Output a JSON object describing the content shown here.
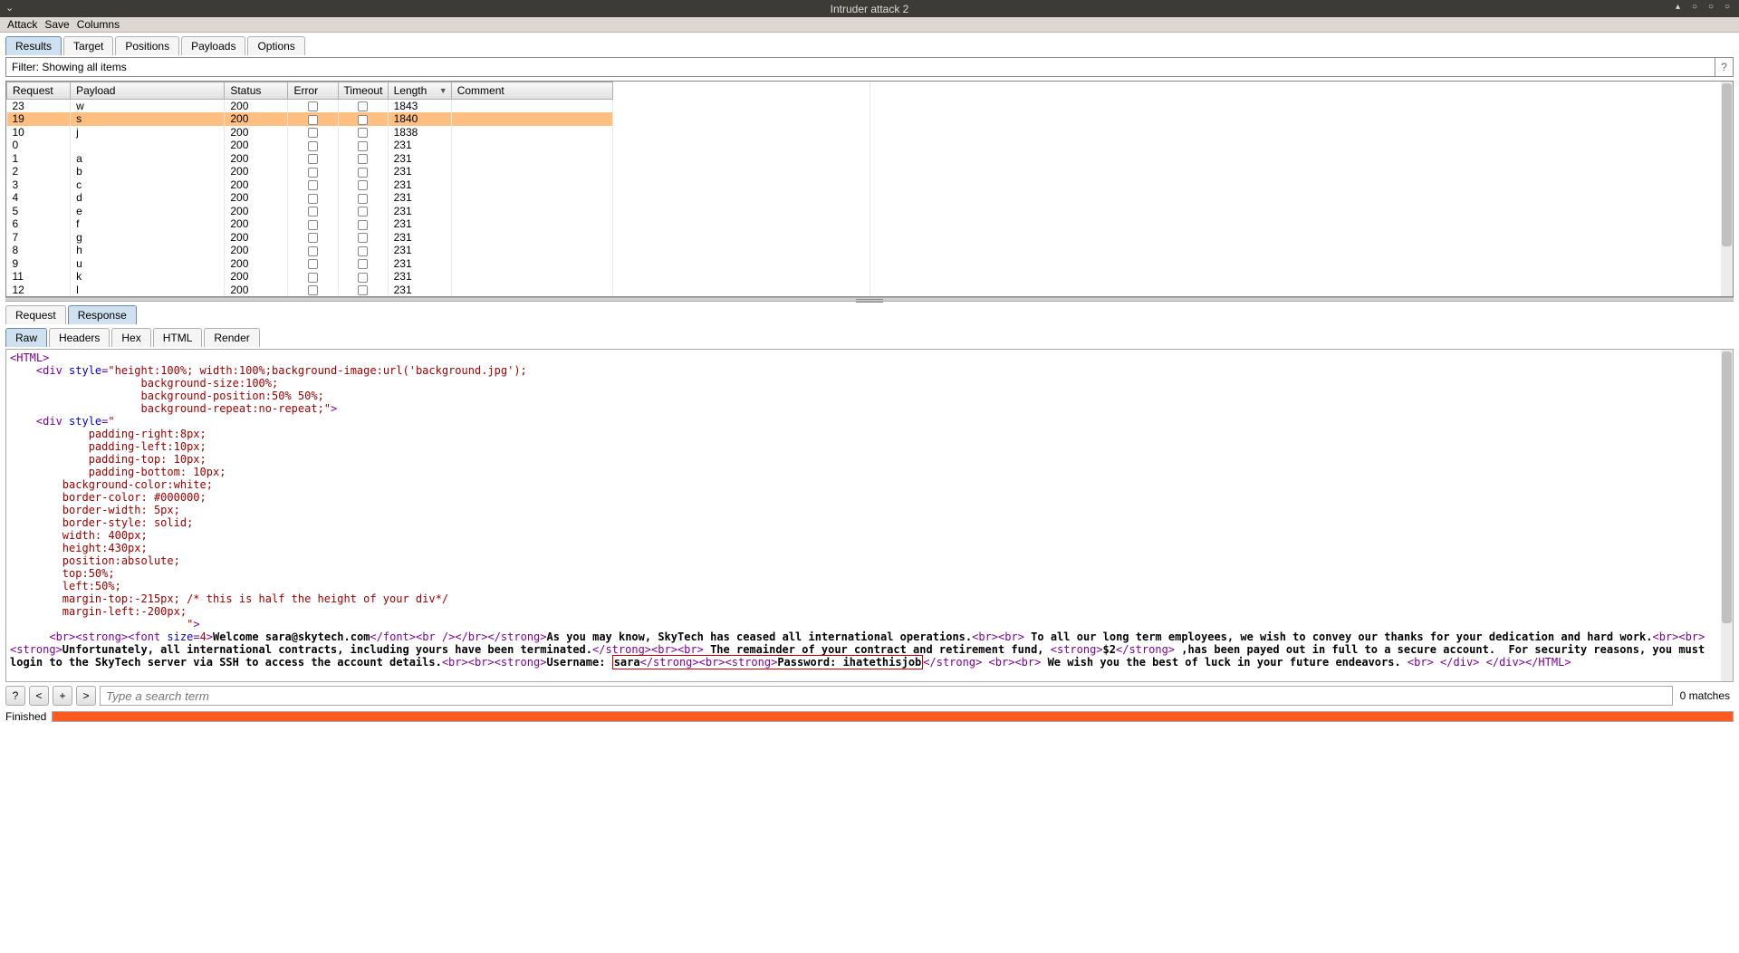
{
  "title": "Intruder attack 2",
  "menubar": {
    "items": [
      "Attack",
      "Save",
      "Columns"
    ]
  },
  "main_tabs": [
    "Results",
    "Target",
    "Positions",
    "Payloads",
    "Options"
  ],
  "main_tab_active": 0,
  "filter": {
    "text": "Filter: Showing all items"
  },
  "columns": [
    "Request",
    "Payload",
    "Status",
    "Error",
    "Timeout",
    "Length",
    "Comment"
  ],
  "sort_column": 5,
  "rows": [
    {
      "request": "23",
      "payload": "w",
      "status": "200",
      "length": "1843",
      "selected": false
    },
    {
      "request": "19",
      "payload": "s",
      "status": "200",
      "length": "1840",
      "selected": true
    },
    {
      "request": "10",
      "payload": "j",
      "status": "200",
      "length": "1838",
      "selected": false
    },
    {
      "request": "0",
      "payload": "",
      "status": "200",
      "length": "231",
      "selected": false
    },
    {
      "request": "1",
      "payload": "a",
      "status": "200",
      "length": "231",
      "selected": false
    },
    {
      "request": "2",
      "payload": "b",
      "status": "200",
      "length": "231",
      "selected": false
    },
    {
      "request": "3",
      "payload": "c",
      "status": "200",
      "length": "231",
      "selected": false
    },
    {
      "request": "4",
      "payload": "d",
      "status": "200",
      "length": "231",
      "selected": false
    },
    {
      "request": "5",
      "payload": "e",
      "status": "200",
      "length": "231",
      "selected": false
    },
    {
      "request": "6",
      "payload": "f",
      "status": "200",
      "length": "231",
      "selected": false
    },
    {
      "request": "7",
      "payload": "g",
      "status": "200",
      "length": "231",
      "selected": false
    },
    {
      "request": "8",
      "payload": "h",
      "status": "200",
      "length": "231",
      "selected": false
    },
    {
      "request": "9",
      "payload": "u",
      "status": "200",
      "length": "231",
      "selected": false
    },
    {
      "request": "11",
      "payload": "k",
      "status": "200",
      "length": "231",
      "selected": false
    },
    {
      "request": "12",
      "payload": "l",
      "status": "200",
      "length": "231",
      "selected": false
    }
  ],
  "sub_tabs": [
    "Request",
    "Response"
  ],
  "sub_tab_active": 1,
  "view_tabs": [
    "Raw",
    "Headers",
    "Hex",
    "HTML",
    "Render"
  ],
  "view_tab_active": 0,
  "search": {
    "placeholder": "Type a search term",
    "matches": "0 matches",
    "btn_help": "?",
    "btn_prev": "<",
    "btn_next": ">",
    "btn_add": "+"
  },
  "status": {
    "label": "Finished"
  },
  "response_tokens": [
    {
      "t": "tag",
      "v": "<HTML>"
    },
    {
      "t": "nl"
    },
    {
      "t": "sp",
      "v": "    "
    },
    {
      "t": "tag",
      "v": "<div "
    },
    {
      "t": "attr",
      "v": "style"
    },
    {
      "t": "tag",
      "v": "="
    },
    {
      "t": "val",
      "v": "\"height:100%; width:100%;background-image:url('background.jpg');"
    },
    {
      "t": "nl"
    },
    {
      "t": "sp",
      "v": "                    "
    },
    {
      "t": "val",
      "v": "background-size:100%;"
    },
    {
      "t": "nl"
    },
    {
      "t": "sp",
      "v": "                    "
    },
    {
      "t": "val",
      "v": "background-position:50% 50%;"
    },
    {
      "t": "nl"
    },
    {
      "t": "sp",
      "v": "                    "
    },
    {
      "t": "val",
      "v": "background-repeat:no-repeat;\""
    },
    {
      "t": "tag",
      "v": ">"
    },
    {
      "t": "nl"
    },
    {
      "t": "sp",
      "v": "    "
    },
    {
      "t": "tag",
      "v": "<div "
    },
    {
      "t": "attr",
      "v": "style"
    },
    {
      "t": "tag",
      "v": "="
    },
    {
      "t": "val",
      "v": "\""
    },
    {
      "t": "nl"
    },
    {
      "t": "sp",
      "v": "            "
    },
    {
      "t": "val",
      "v": "padding-right:8px;"
    },
    {
      "t": "nl"
    },
    {
      "t": "sp",
      "v": "            "
    },
    {
      "t": "val",
      "v": "padding-left:10px;"
    },
    {
      "t": "nl"
    },
    {
      "t": "sp",
      "v": "            "
    },
    {
      "t": "val",
      "v": "padding-top: 10px;"
    },
    {
      "t": "nl"
    },
    {
      "t": "sp",
      "v": "            "
    },
    {
      "t": "val",
      "v": "padding-bottom: 10px;"
    },
    {
      "t": "nl"
    },
    {
      "t": "sp",
      "v": "        "
    },
    {
      "t": "val",
      "v": "background-color:white;"
    },
    {
      "t": "nl"
    },
    {
      "t": "sp",
      "v": "        "
    },
    {
      "t": "val",
      "v": "border-color: #000000;"
    },
    {
      "t": "nl"
    },
    {
      "t": "sp",
      "v": "        "
    },
    {
      "t": "val",
      "v": "border-width: 5px;"
    },
    {
      "t": "nl"
    },
    {
      "t": "sp",
      "v": "        "
    },
    {
      "t": "val",
      "v": "border-style: solid;"
    },
    {
      "t": "nl"
    },
    {
      "t": "sp",
      "v": "        "
    },
    {
      "t": "val",
      "v": "width: 400px;"
    },
    {
      "t": "nl"
    },
    {
      "t": "sp",
      "v": "        "
    },
    {
      "t": "val",
      "v": "height:430px;"
    },
    {
      "t": "nl"
    },
    {
      "t": "sp",
      "v": "        "
    },
    {
      "t": "val",
      "v": "position:absolute;"
    },
    {
      "t": "nl"
    },
    {
      "t": "sp",
      "v": "        "
    },
    {
      "t": "val",
      "v": "top:50%;"
    },
    {
      "t": "nl"
    },
    {
      "t": "sp",
      "v": "        "
    },
    {
      "t": "val",
      "v": "left:50%;"
    },
    {
      "t": "nl"
    },
    {
      "t": "sp",
      "v": "        "
    },
    {
      "t": "val",
      "v": "margin-top:-215px; /* this is half the height of your div*/"
    },
    {
      "t": "nl"
    },
    {
      "t": "sp",
      "v": "        "
    },
    {
      "t": "val",
      "v": "margin-left:-200px;"
    },
    {
      "t": "nl"
    },
    {
      "t": "sp",
      "v": "                           "
    },
    {
      "t": "val",
      "v": "\""
    },
    {
      "t": "tag",
      "v": ">"
    },
    {
      "t": "nl"
    },
    {
      "t": "sp",
      "v": "      "
    },
    {
      "t": "tag",
      "v": "<br>"
    },
    {
      "t": "tag",
      "v": "<strong>"
    },
    {
      "t": "tag",
      "v": "<font "
    },
    {
      "t": "attr",
      "v": "size"
    },
    {
      "t": "tag",
      "v": "="
    },
    {
      "t": "val",
      "v": "4"
    },
    {
      "t": "tag",
      "v": ">"
    },
    {
      "t": "text",
      "v": "Welcome sara@skytech.com"
    },
    {
      "t": "tag",
      "v": "</font>"
    },
    {
      "t": "tag",
      "v": "<br />"
    },
    {
      "t": "tag",
      "v": "</br>"
    },
    {
      "t": "tag",
      "v": "</strong>"
    },
    {
      "t": "text",
      "v": "As you may know, SkyTech has ceased all international operations."
    },
    {
      "t": "tag",
      "v": "<br>"
    },
    {
      "t": "tag",
      "v": "<br>"
    },
    {
      "t": "text",
      "v": " To all our long term employees, we wish to convey our thanks for your dedication and hard work."
    },
    {
      "t": "tag",
      "v": "<br>"
    },
    {
      "t": "tag",
      "v": "<br>"
    },
    {
      "t": "tag",
      "v": "<strong>"
    },
    {
      "t": "text",
      "v": "Unfortunately, all international contracts, including yours have been terminated."
    },
    {
      "t": "tag",
      "v": "</strong>"
    },
    {
      "t": "tag",
      "v": "<br>"
    },
    {
      "t": "tag",
      "v": "<br>"
    },
    {
      "t": "text",
      "v": " The remainder of your contract and retirement fund, "
    },
    {
      "t": "tag",
      "v": "<strong>"
    },
    {
      "t": "text",
      "v": "$2"
    },
    {
      "t": "tag",
      "v": "</strong>"
    },
    {
      "t": "text",
      "v": " ,has been payed out in full to a secure account.  For security reasons, you must login to the SkyTech server via SSH to access the account details."
    },
    {
      "t": "tag",
      "v": "<br>"
    },
    {
      "t": "tag",
      "v": "<br>"
    },
    {
      "t": "tag",
      "v": "<strong>"
    },
    {
      "t": "text",
      "v": "Username: "
    },
    {
      "t": "hl-start"
    },
    {
      "t": "text",
      "v": "sara"
    },
    {
      "t": "tag",
      "v": "</strong>"
    },
    {
      "t": "tag",
      "v": "<br>"
    },
    {
      "t": "tag",
      "v": "<strong>"
    },
    {
      "t": "text",
      "v": "Password: ihatethisjob"
    },
    {
      "t": "hl-end"
    },
    {
      "t": "tag",
      "v": "</strong>"
    },
    {
      "t": "tag",
      "v": " <br>"
    },
    {
      "t": "tag",
      "v": "<br>"
    },
    {
      "t": "text",
      "v": " We wish you the best of luck in your future endeavors. "
    },
    {
      "t": "tag",
      "v": "<br>"
    },
    {
      "t": "tag",
      "v": " </div>"
    },
    {
      "t": "tag",
      "v": " </div>"
    },
    {
      "t": "tag",
      "v": "</HTML>"
    }
  ]
}
